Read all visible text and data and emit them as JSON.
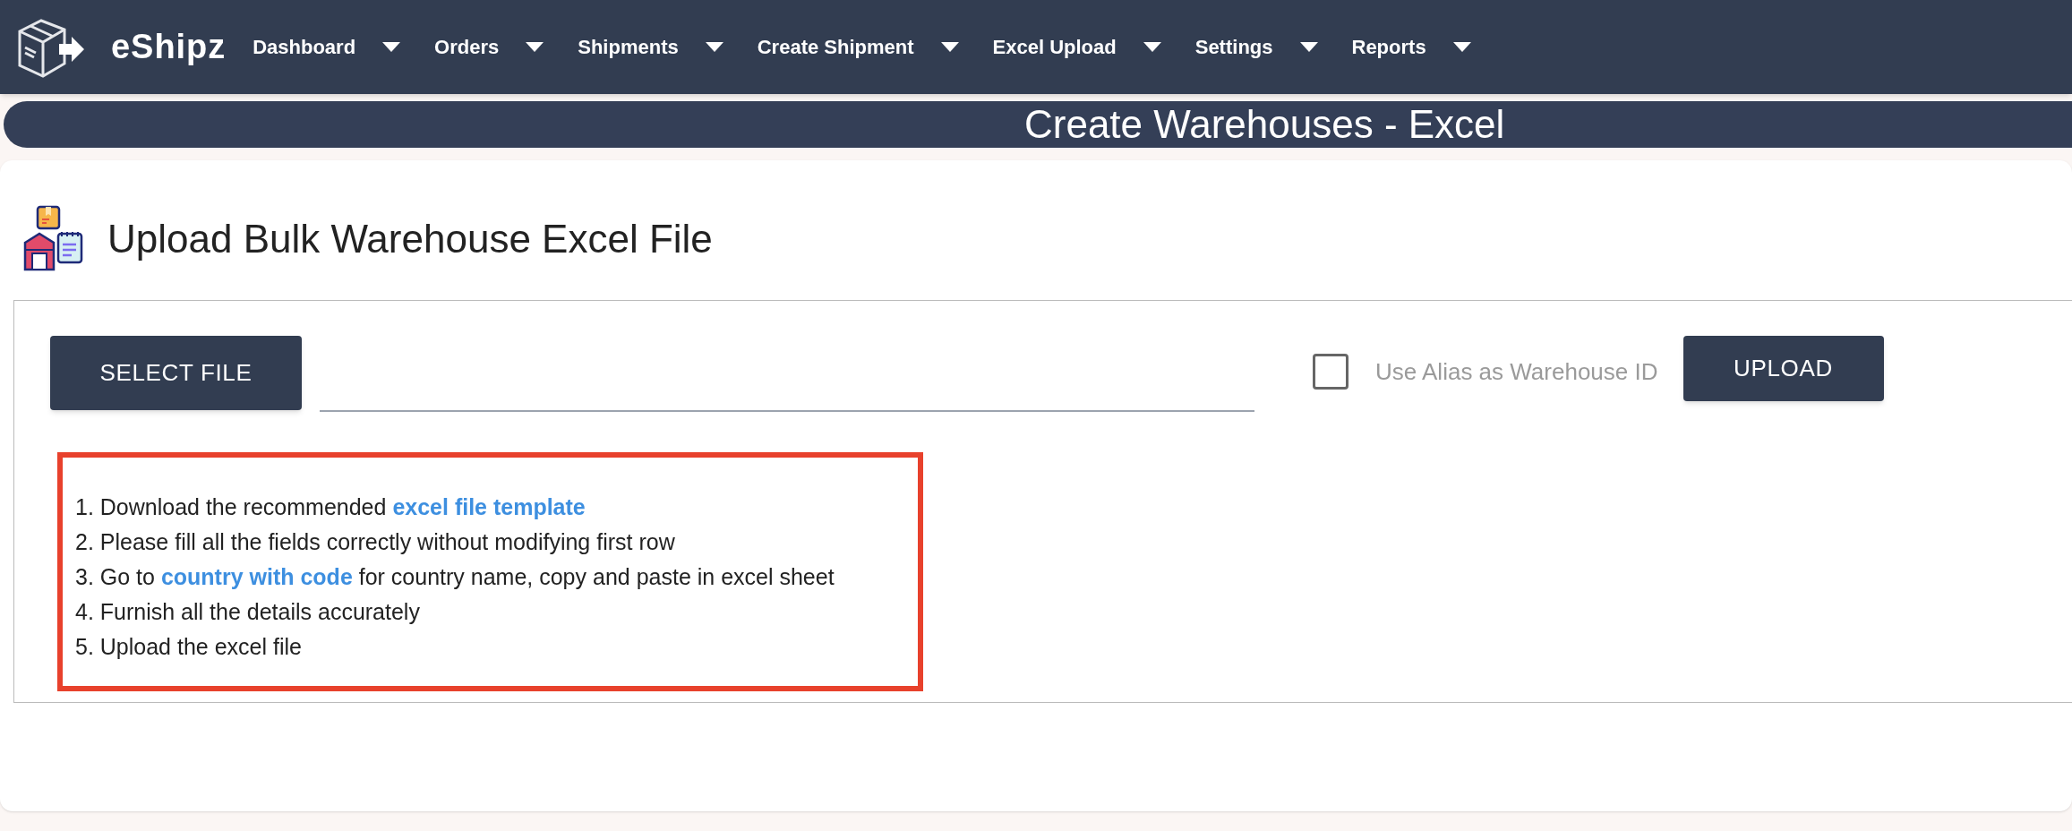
{
  "brand": "eShipz",
  "nav": [
    {
      "label": "Dashboard"
    },
    {
      "label": "Orders"
    },
    {
      "label": "Shipments"
    },
    {
      "label": "Create Shipment"
    },
    {
      "label": "Excel Upload"
    },
    {
      "label": "Settings"
    },
    {
      "label": "Reports"
    }
  ],
  "page_title": "Create Warehouses - Excel",
  "heading": "Upload Bulk Warehouse Excel File",
  "select_button": "SELECT FILE",
  "alias_checkbox": {
    "label": "Use Alias as Warehouse ID",
    "checked": false
  },
  "upload_button": "UPLOAD",
  "instructions": [
    [
      {
        "kind": "text",
        "text": "1. Download the recommended "
      },
      {
        "kind": "link",
        "text": "excel file template"
      }
    ],
    [
      {
        "kind": "text",
        "text": "2. Please fill all the fields correctly without modifying first row"
      }
    ],
    [
      {
        "kind": "text",
        "text": "3. Go to "
      },
      {
        "kind": "link",
        "text": "country with code"
      },
      {
        "kind": "text",
        "text": " for country name, copy and paste in excel sheet"
      }
    ],
    [
      {
        "kind": "text",
        "text": "4. Furnish all the details accurately"
      }
    ],
    [
      {
        "kind": "text",
        "text": "5. Upload the excel file"
      }
    ]
  ]
}
